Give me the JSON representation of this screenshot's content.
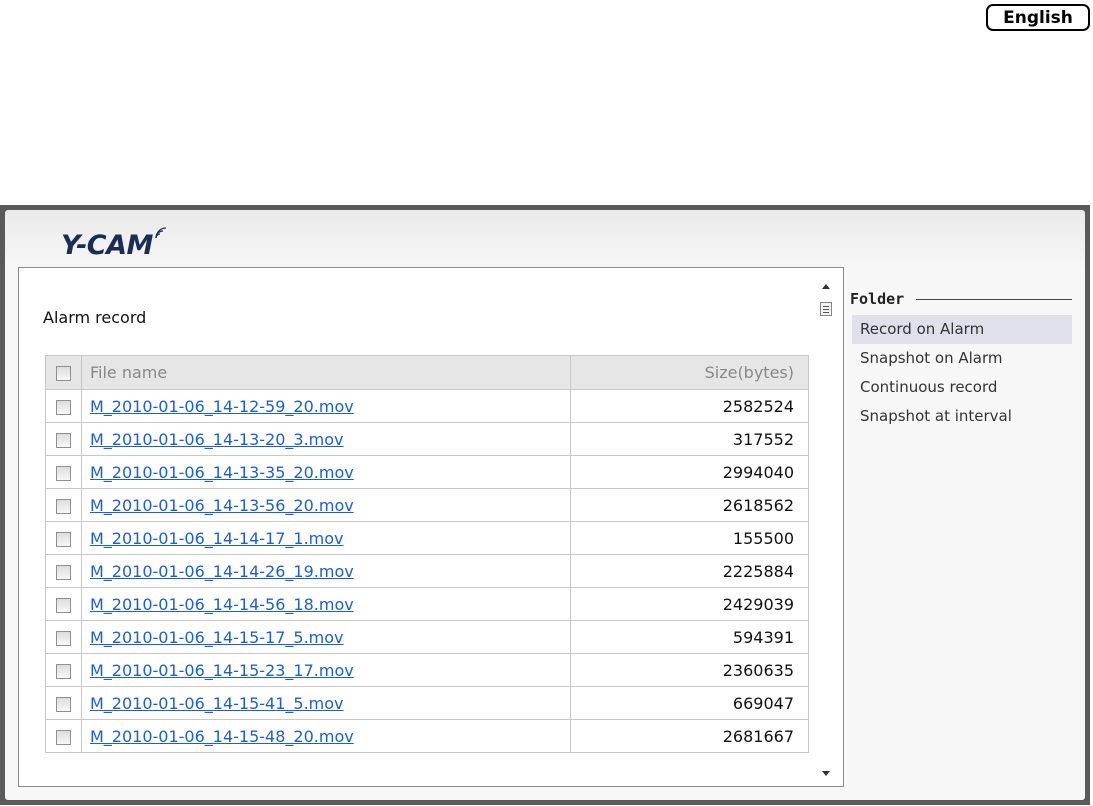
{
  "language_button": "English",
  "brand": {
    "logo_text": "Y-CAM"
  },
  "section_title": "Alarm record",
  "table": {
    "headers": {
      "name": "File name",
      "size": "Size(bytes)"
    },
    "rows": [
      {
        "name": "M_2010-01-06_14-12-59_20.mov",
        "size": "2582524"
      },
      {
        "name": "M_2010-01-06_14-13-20_3.mov",
        "size": "317552"
      },
      {
        "name": "M_2010-01-06_14-13-35_20.mov",
        "size": "2994040"
      },
      {
        "name": "M_2010-01-06_14-13-56_20.mov",
        "size": "2618562"
      },
      {
        "name": "M_2010-01-06_14-14-17_1.mov",
        "size": "155500"
      },
      {
        "name": "M_2010-01-06_14-14-26_19.mov",
        "size": "2225884"
      },
      {
        "name": "M_2010-01-06_14-14-56_18.mov",
        "size": "2429039"
      },
      {
        "name": "M_2010-01-06_14-15-17_5.mov",
        "size": "594391"
      },
      {
        "name": "M_2010-01-06_14-15-23_17.mov",
        "size": "2360635"
      },
      {
        "name": "M_2010-01-06_14-15-41_5.mov",
        "size": "669047"
      },
      {
        "name": "M_2010-01-06_14-15-48_20.mov",
        "size": "2681667"
      }
    ]
  },
  "folder": {
    "title": "Folder",
    "items": [
      {
        "label": "Record on Alarm",
        "active": true
      },
      {
        "label": "Snapshot on Alarm",
        "active": false
      },
      {
        "label": "Continuous record",
        "active": false
      },
      {
        "label": "Snapshot at interval",
        "active": false
      }
    ]
  }
}
